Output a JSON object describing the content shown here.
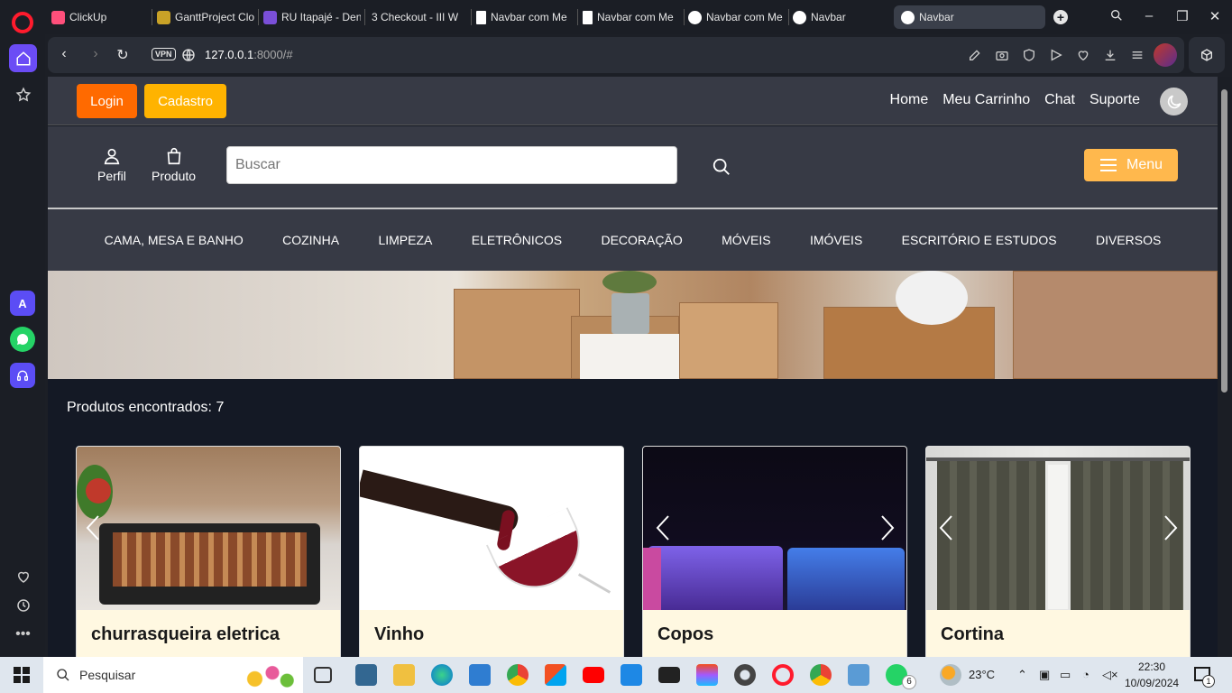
{
  "browser": {
    "tabs": [
      {
        "label": "ClickUp",
        "color": "#ff4f7b"
      },
      {
        "label": "GanttProject Clo",
        "color": "#c9a227"
      },
      {
        "label": "RU Itapajé - Den",
        "color": "#7a4fd8"
      },
      {
        "label": "3 Checkout - III W",
        "color": "#ffffff"
      },
      {
        "label": "Navbar com Me",
        "color": "#ffffff"
      },
      {
        "label": "Navbar com Me",
        "color": "#ffffff"
      },
      {
        "label": "Navbar com Me",
        "color": "#ffffff"
      },
      {
        "label": "Navbar",
        "color": "#ffffff"
      },
      {
        "label": "Navbar",
        "color": "#ffffff"
      }
    ],
    "url_host": "127.0.0.1",
    "url_rest": ":8000/#",
    "vpn_label": "VPN"
  },
  "topnav": {
    "login": "Login",
    "cadastro": "Cadastro",
    "links": [
      "Home",
      "Meu Carrinho",
      "Chat",
      "Suporte"
    ]
  },
  "midbar": {
    "perfil": "Perfil",
    "produto": "Produto",
    "search_placeholder": "Buscar",
    "menu": "Menu"
  },
  "categories": [
    "CAMA, MESA E BANHO",
    "COZINHA",
    "LIMPEZA",
    "ELETRÔNICOS",
    "DECORAÇÃO",
    "MÓVEIS",
    "IMÓVEIS",
    "ESCRITÓRIO E ESTUDOS",
    "DIVERSOS"
  ],
  "results": {
    "label": "Produtos encontrados: 7"
  },
  "products": [
    {
      "title": "churrasqueira eletrica"
    },
    {
      "title": "Vinho"
    },
    {
      "title": "Copos"
    },
    {
      "title": "Cortina"
    }
  ],
  "taskbar": {
    "search": "Pesquisar",
    "weather": "23°C",
    "time": "22:30",
    "date": "10/09/2024",
    "whatsapp_badge": "6",
    "notif_badge": "1"
  },
  "colors": {
    "login": "#ff6a00",
    "cadastro": "#ffb300",
    "menu": "#ffb84d",
    "nav_bg": "#373a45",
    "page_bg": "#141925",
    "card_bg": "#fff8e1"
  }
}
